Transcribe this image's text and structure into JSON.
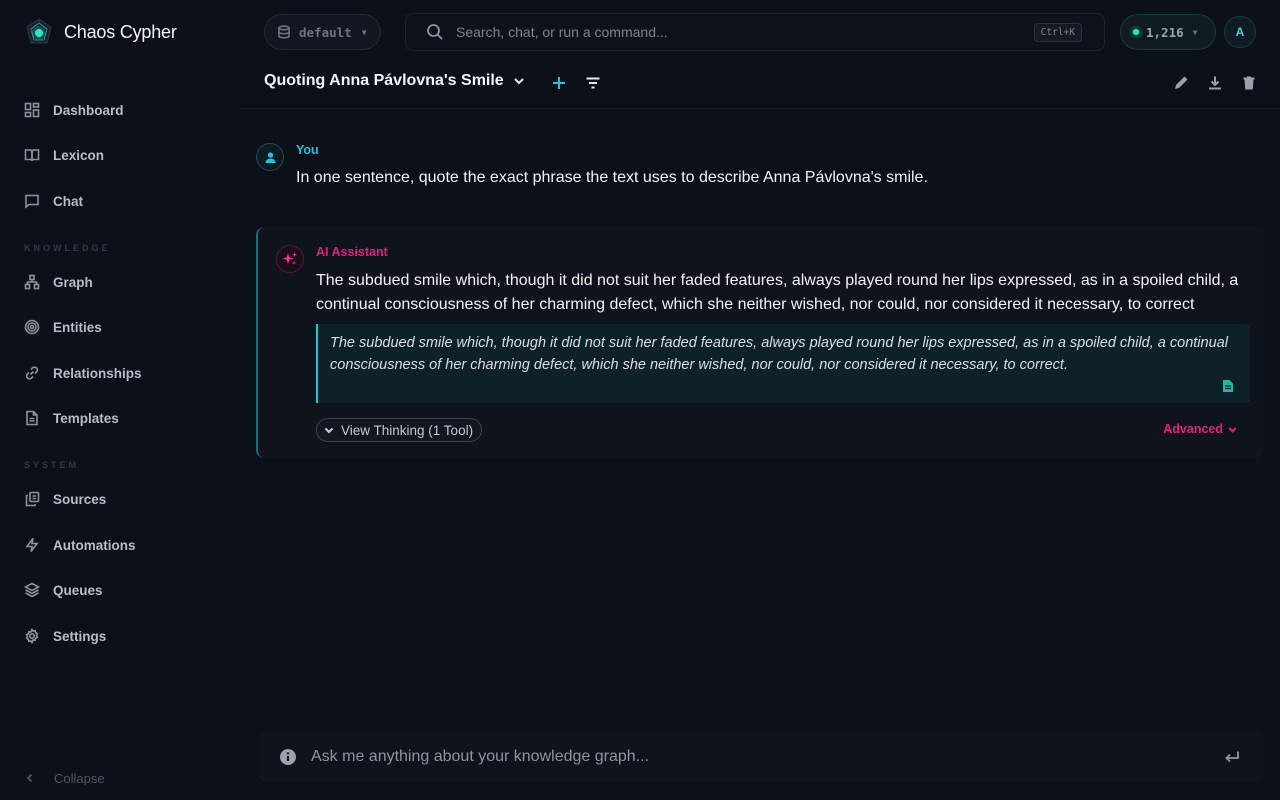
{
  "app": {
    "name": "Chaos Cypher"
  },
  "colors": {
    "accent_cyan": "#22c1dd",
    "accent_pink": "#e01f80",
    "background": "#0b0f17"
  },
  "sidebar": {
    "items_top": [
      {
        "label": "Dashboard",
        "icon": "dashboard-icon"
      },
      {
        "label": "Lexicon",
        "icon": "book-icon"
      },
      {
        "label": "Chat",
        "icon": "chat-icon"
      }
    ],
    "section_knowledge": "KNOWLEDGE",
    "items_knowledge": [
      {
        "label": "Graph",
        "icon": "graph-icon"
      },
      {
        "label": "Entities",
        "icon": "target-icon"
      },
      {
        "label": "Relationships",
        "icon": "link-icon"
      },
      {
        "label": "Templates",
        "icon": "file-icon"
      }
    ],
    "section_system": "SYSTEM",
    "items_system": [
      {
        "label": "Sources",
        "icon": "sources-icon"
      },
      {
        "label": "Automations",
        "icon": "bolt-icon"
      },
      {
        "label": "Queues",
        "icon": "layers-icon"
      },
      {
        "label": "Settings",
        "icon": "gear-icon"
      }
    ],
    "collapse_label": "Collapse"
  },
  "topbar": {
    "workspace": "default",
    "search_placeholder": "Search, chat, or run a command...",
    "search_shortcut": "Ctrl+K",
    "credits": "1,216",
    "avatar_initial": "A"
  },
  "chat": {
    "title": "Quoting Anna Pávlovna's Smile",
    "messages": {
      "user": {
        "sender": "You",
        "text": "In one sentence, quote the exact phrase the text uses to describe Anna Pávlovna's smile."
      },
      "assistant": {
        "sender": "AI Assistant",
        "text": "The subdued smile which, though it did not suit her faded features, always played round her lips expressed, as in a spoiled child, a continual consciousness of her charming defect, which she neither wished, nor could, nor considered it necessary, to correct",
        "quote": "The subdued smile which, though it did not suit her faded features, always played round her lips expressed, as in a spoiled child, a continual consciousness of her charming defect, which she neither wished, nor could, nor considered it necessary, to correct.",
        "thinking_label": "View Thinking (1 Tool)",
        "advanced_label": "Advanced"
      }
    },
    "composer_placeholder": "Ask me anything about your knowledge graph..."
  }
}
